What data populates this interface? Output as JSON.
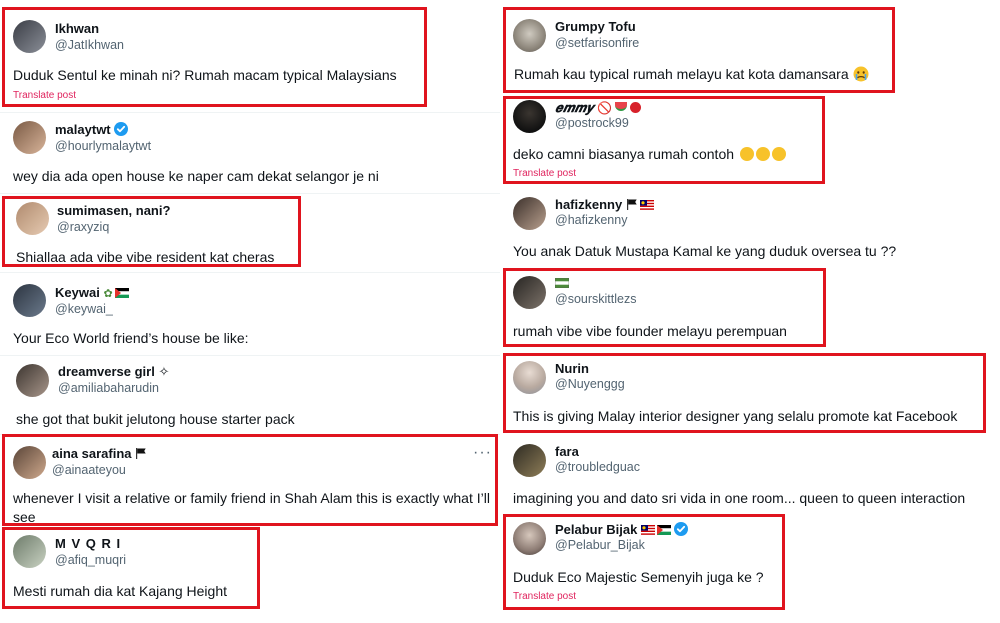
{
  "left": [
    {
      "name": "Ikhwan",
      "handle": "@JatIkhwan",
      "text": "Duduk Sentul ke minah ni? Rumah macam typical Malaysians",
      "translate": "Translate post"
    },
    {
      "name": "malaytwt",
      "handle": "@hourlymalaytwt",
      "text": "wey dia ada open house ke naper cam dekat selangor je ni",
      "verified": true
    },
    {
      "name": "sumimasen, nani?",
      "handle": "@raxyziq",
      "text": "Shiallaa ada vibe vibe resident kat cheras"
    },
    {
      "name": "Keywai",
      "handle": "@keywai_",
      "text": "Your Eco World friend’s house be like:"
    },
    {
      "name": "dreamverse girl ✧",
      "handle": "@amiliabaharudin",
      "text": "she got that bukit jelutong house starter pack"
    },
    {
      "name": "aina sarafina",
      "handle": "@ainaateyou",
      "text": "whenever I visit a relative or family friend in Shah Alam this is exactly what I’ll see",
      "more": "···"
    },
    {
      "name": "M V Q R I",
      "handle": "@afiq_muqri",
      "text": "Mesti rumah dia kat Kajang Height"
    }
  ],
  "right": [
    {
      "name": "Grumpy Tofu",
      "handle": "@setfarisonfire",
      "text": "Rumah kau typical rumah melayu kat kota damansara"
    },
    {
      "name": "𝒆𝒎𝒎𝒚",
      "handle": "@postrock99",
      "text": "deko camni biasanya rumah contoh",
      "translate": "Translate post"
    },
    {
      "name": "hafizkenny",
      "handle": "@hafizkenny",
      "text": "You anak Datuk Mustapa Kamal ke yang duduk oversea tu ??"
    },
    {
      "name": "",
      "handle": "@sourskittlezs",
      "text": "rumah vibe vibe founder melayu perempuan"
    },
    {
      "name": "Nurin",
      "handle": "@Nuyenggg",
      "text": "This is giving Malay interior designer yang selalu promote kat Facebook"
    },
    {
      "name": "fara",
      "handle": "@troubledguac",
      "text": "imagining you and dato sri vida in one room... queen to queen interaction"
    },
    {
      "name": "Pelabur Bijak",
      "handle": "@Pelabur_Bijak",
      "text": "Duduk Eco Majestic Semenyih juga ke ?",
      "translate": "Translate post",
      "verified": true
    }
  ],
  "colors": {
    "highlight": "#e0141e",
    "verified": "#1d9bf0",
    "translate": "#e0245e",
    "handle": "#536471"
  },
  "icons": {
    "verified": "verified-badge-icon",
    "more": "more-options-icon"
  }
}
